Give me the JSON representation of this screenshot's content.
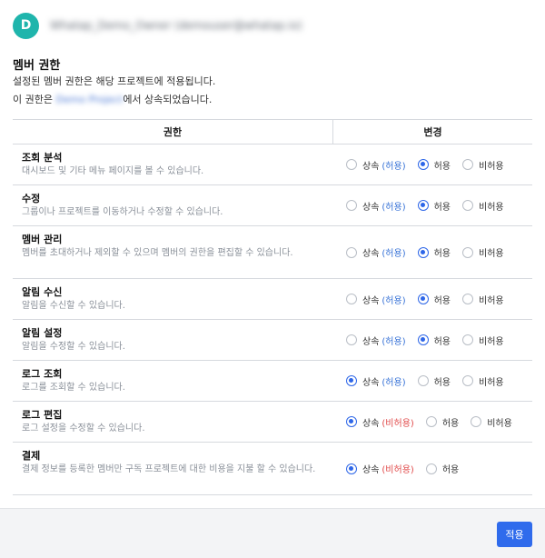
{
  "header": {
    "avatar_letter": "D",
    "account_text": "Whatap_Demo_Owner (demouser@whatap.io)"
  },
  "section": {
    "title": "멤버 권한",
    "description": "설정된 멤버 권한은 해당 프로젝트에 적용됩니다.",
    "inherit_prefix": "이 권한은 ",
    "inherit_project": "Demo Project",
    "inherit_suffix": "에서 상속되었습니다."
  },
  "table": {
    "headers": {
      "permission": "권한",
      "change": "변경"
    },
    "rows": [
      {
        "name": "조회 분석",
        "desc": "대시보드 및 기타 메뉴 페이지를 볼 수 있습니다.",
        "inherit_label": "상속",
        "inherit_hint": "(허용)",
        "allow_label": "허용",
        "deny_label": "비허용",
        "selected": "allow"
      },
      {
        "name": "수정",
        "desc": "그룹이나 프로젝트를 이동하거나 수정할 수 있습니다.",
        "inherit_label": "상속",
        "inherit_hint": "(허용)",
        "allow_label": "허용",
        "deny_label": "비허용",
        "selected": "allow"
      },
      {
        "name": "멤버 관리",
        "desc": "멤버를 초대하거나 제외할 수 있으며 멤버의 권한을 편집할 수 있습니다.",
        "inherit_label": "상속",
        "inherit_hint": "(허용)",
        "allow_label": "허용",
        "deny_label": "비허용",
        "selected": "allow"
      },
      {
        "name": "알림 수신",
        "desc": "알림을 수신할 수 있습니다.",
        "inherit_label": "상속",
        "inherit_hint": "(허용)",
        "allow_label": "허용",
        "deny_label": "비허용",
        "selected": "allow"
      },
      {
        "name": "알림 설정",
        "desc": "알림을 수정할 수 있습니다.",
        "inherit_label": "상속",
        "inherit_hint": "(허용)",
        "allow_label": "허용",
        "deny_label": "비허용",
        "selected": "allow"
      },
      {
        "name": "로그 조회",
        "desc": "로그를 조회할 수 있습니다.",
        "inherit_label": "상속",
        "inherit_hint": "(허용)",
        "allow_label": "허용",
        "deny_label": "비허용",
        "selected": "inherit"
      },
      {
        "name": "로그 편집",
        "desc": "로그 설정을 수정할 수 있습니다.",
        "inherit_label": "상속",
        "inherit_hint": "(비허용)",
        "allow_label": "허용",
        "deny_label": "비허용",
        "selected": "inherit"
      },
      {
        "name": "결제",
        "desc": "결제 정보를 등록한 멤버만 구독 프로젝트에 대한 비용을 지불 할 수 있습니다.",
        "inherit_label": "상속",
        "inherit_hint": "(비허용)",
        "allow_label": "허용",
        "deny_label": "",
        "selected": "inherit"
      }
    ]
  },
  "footer": {
    "apply_label": "적용"
  },
  "colors": {
    "accent": "#2f6bec",
    "avatar": "#1fb5ac",
    "allow_hint": "#3470d6",
    "deny_hint": "#e04848"
  }
}
